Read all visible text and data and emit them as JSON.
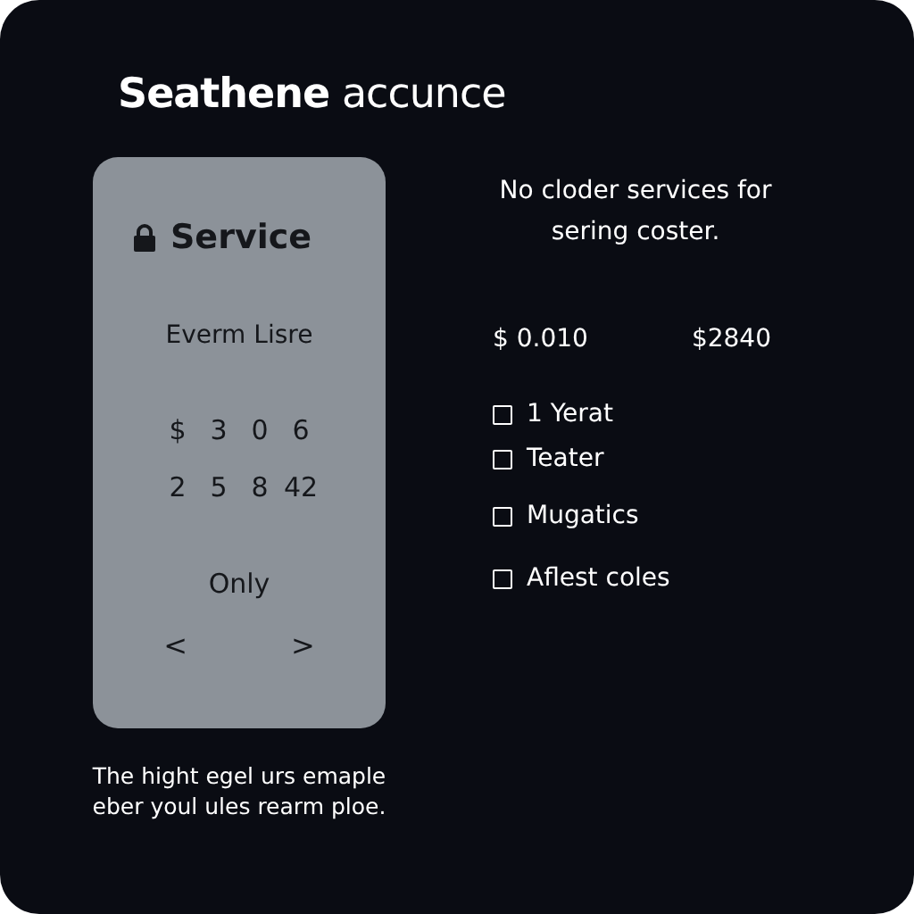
{
  "title": "**Seathene** accunce",
  "card": {
    "heading": "Service",
    "subtitle": "Everm Lisre",
    "rows": [
      [
        "$",
        "3",
        "0",
        "6"
      ],
      [
        "2",
        "5",
        "8",
        "42"
      ]
    ],
    "label": "Only",
    "prev": "<",
    "next": ">"
  },
  "caption": "The hight egel urs emaple eber youl ules rearm ploe.",
  "notice": "No cloder services for sering coster.",
  "prices": [
    "$ 0.010",
    "$2840"
  ],
  "options": [
    {
      "label": "1 Yerat",
      "checked": false
    },
    {
      "label": "Teater",
      "checked": false
    },
    {
      "label": "Mugatics",
      "checked": false
    },
    {
      "label": "Aflest coles",
      "checked": false
    }
  ]
}
